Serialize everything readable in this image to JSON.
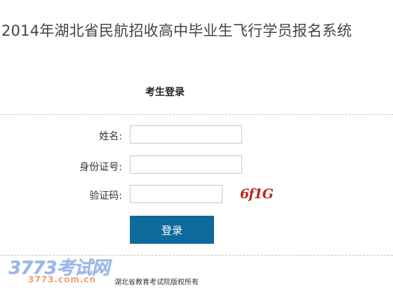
{
  "page_title": "2014年湖北省民航招收高中毕业生飞行学员报名系统",
  "login": {
    "heading": "考生登录",
    "name_label": "姓名:",
    "name_value": "",
    "id_label": "身份证号:",
    "id_value": "",
    "code_label": "验证码:",
    "code_value": "",
    "captcha_text": "6f1G",
    "button_label": "登录"
  },
  "footer": {
    "copyright": "湖北省教育考试院版权所有"
  },
  "watermark": {
    "main": "3773考试网",
    "sub": "3773.com.cn"
  },
  "colors": {
    "button": "#0f6b9c",
    "captcha": "#b52a1c"
  }
}
